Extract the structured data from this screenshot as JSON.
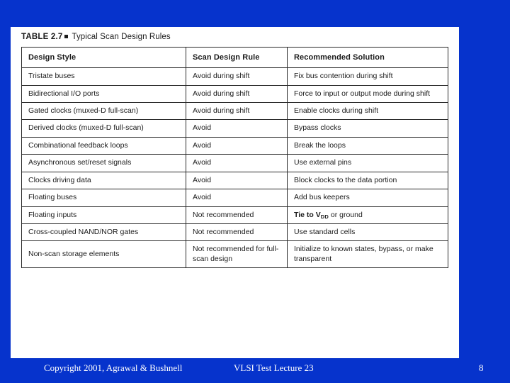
{
  "slide": {
    "background_color": "#0633cc",
    "panel_color": "#ffffff"
  },
  "caption": {
    "label": "TABLE 2.7",
    "marker": "filled-square",
    "title": "Typical Scan Design Rules"
  },
  "table": {
    "headers": [
      "Design Style",
      "Scan Design Rule",
      "Recommended Solution"
    ],
    "rows": [
      {
        "design_style": "Tristate buses",
        "scan_design_rule": "Avoid during shift",
        "recommended_solution": "Fix bus contention during shift"
      },
      {
        "design_style": "Bidirectional I/O ports",
        "scan_design_rule": "Avoid during shift",
        "recommended_solution": "Force to input or output mode during shift"
      },
      {
        "design_style": "Gated clocks (muxed-D full-scan)",
        "scan_design_rule": "Avoid during shift",
        "recommended_solution": "Enable clocks during shift"
      },
      {
        "design_style": "Derived clocks (muxed-D full-scan)",
        "scan_design_rule": "Avoid",
        "recommended_solution": "Bypass clocks"
      },
      {
        "design_style": "Combinational feedback loops",
        "scan_design_rule": "Avoid",
        "recommended_solution": "Break the loops"
      },
      {
        "design_style": "Asynchronous set/reset signals",
        "scan_design_rule": "Avoid",
        "recommended_solution": "Use external pins"
      },
      {
        "design_style": "Clocks driving data",
        "scan_design_rule": "Avoid",
        "recommended_solution": "Block clocks to the data portion"
      },
      {
        "design_style": "Floating buses",
        "scan_design_rule": "Avoid",
        "recommended_solution": "Add bus keepers"
      },
      {
        "design_style": "Floating inputs",
        "scan_design_rule": "Not recommended",
        "recommended_solution_pre": "Tie to V",
        "recommended_solution_sub": "DD",
        "recommended_solution_post": " or ground"
      },
      {
        "design_style": "Cross-coupled NAND/NOR gates",
        "scan_design_rule": "Not recommended",
        "recommended_solution": "Use standard cells"
      },
      {
        "design_style": "Non-scan storage elements",
        "scan_design_rule": "Not recommended for full-scan design",
        "recommended_solution": "Initialize to known states, bypass, or make transparent"
      }
    ]
  },
  "footer": {
    "copyright": "Copyright 2001, Agrawal & Bushnell",
    "lecture": "VLSI Test Lecture 23",
    "page_number": "8"
  }
}
